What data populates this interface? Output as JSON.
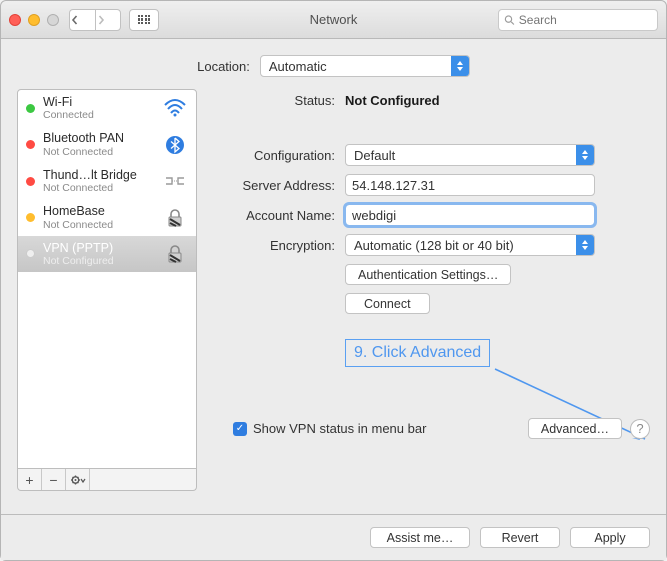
{
  "window": {
    "title": "Network"
  },
  "search": {
    "placeholder": "Search"
  },
  "location": {
    "label": "Location:",
    "value": "Automatic"
  },
  "sidebar": {
    "items": [
      {
        "name": "Wi-Fi",
        "status": "Connected"
      },
      {
        "name": "Bluetooth PAN",
        "status": "Not Connected"
      },
      {
        "name": "Thund…lt Bridge",
        "status": "Not Connected"
      },
      {
        "name": "HomeBase",
        "status": "Not Connected"
      },
      {
        "name": "VPN (PPTP)",
        "status": "Not Configured"
      }
    ]
  },
  "details": {
    "status_label": "Status:",
    "status_value": "Not Configured",
    "config_label": "Configuration:",
    "config_value": "Default",
    "server_label": "Server Address:",
    "server_value": "54.148.127.31",
    "account_label": "Account Name:",
    "account_value": "webdigi",
    "encryption_label": "Encryption:",
    "encryption_value": "Automatic (128 bit or 40 bit)",
    "auth_button": "Authentication Settings…",
    "connect_button": "Connect",
    "show_status_label": "Show VPN status in menu bar",
    "advanced_button": "Advanced…"
  },
  "annotation": {
    "text": "9. Click Advanced"
  },
  "bottom": {
    "assist": "Assist me…",
    "revert": "Revert",
    "apply": "Apply"
  }
}
